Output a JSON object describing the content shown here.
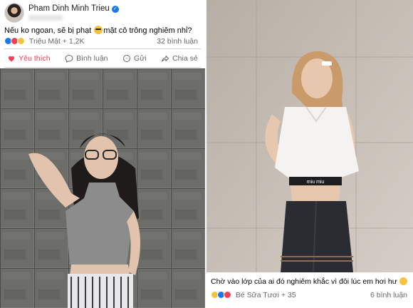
{
  "left_post": {
    "author": "Pham Dinh Minh Trieu",
    "caption_before": "Nếu ko ngoan, sẽ bị phạt ",
    "caption_after": "mặt cô trông nghiêm nhỉ?",
    "reactions_text": "Triệu Mật + 1,2K",
    "comments": "32 bình luận",
    "actions": {
      "like": "Yêu thích",
      "comment": "Bình luận",
      "send": "Gửi",
      "share": "Chia sẻ"
    }
  },
  "right_post": {
    "caption": "Chờ vào lớp của ai đó nghiêm khắc vì đôi lúc em hơi hư",
    "reactions_text": "Bé Sữa Tươi + 35",
    "comments": "6 bình luận",
    "waistband_text": "miu miu"
  },
  "colors": {
    "facebook_blue": "#1877f2",
    "love_red": "#f33e58",
    "haha_yellow": "#f7c33c",
    "secondary_text": "#65676b"
  },
  "icons": [
    "avatar",
    "verified-badge-icon",
    "like-reaction-icon",
    "love-reaction-icon",
    "haha-reaction-icon",
    "heart-icon",
    "comment-icon",
    "messenger-icon",
    "share-icon"
  ]
}
